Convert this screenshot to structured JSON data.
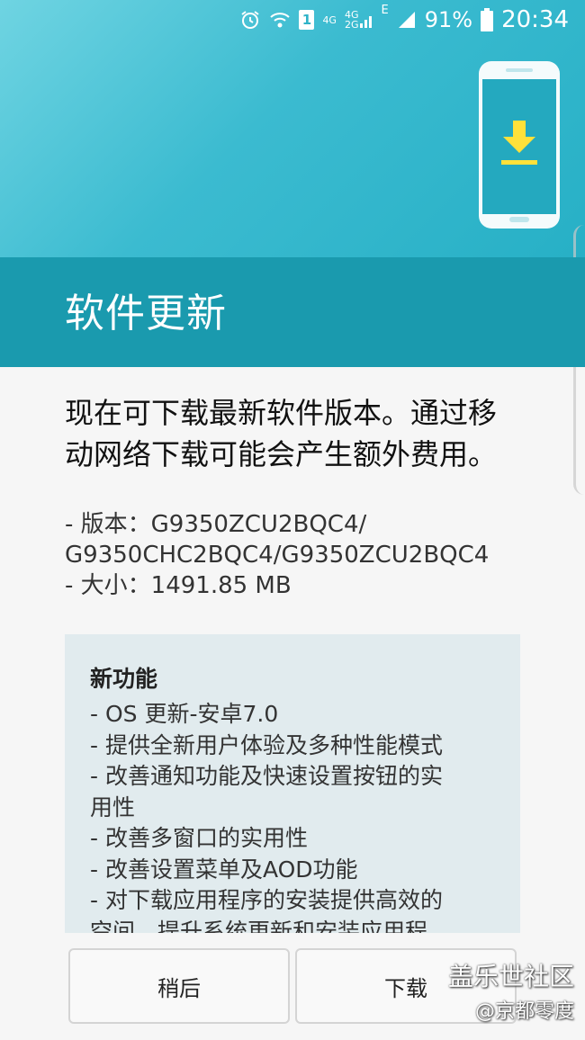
{
  "status_bar": {
    "sim_badge": "1",
    "net_top": "4G",
    "net_bottom": "2G",
    "net_label": "4G",
    "data_type": "E",
    "battery_percent": "91%",
    "time": "20:34"
  },
  "header": {
    "title": "软件更新"
  },
  "content": {
    "intro": "现在可下载最新软件版本。通过移动网络下载可能会产生额外费用。",
    "version_line1": "- 版本：G9350ZCU2BQC4/",
    "version_line2": "G9350CHC2BQC4/G9350ZCU2BQC4",
    "size_line": "- 大小：1491.85 MB"
  },
  "release_notes": {
    "heading": "新功能",
    "items": [
      "- OS 更新-安卓7.0",
      "- 提供全新用户体验及多种性能模式",
      "- 改善通知功能及快速设置按钮的实",
      "用性",
      "- 改善多窗口的实用性",
      "- 改善设置菜单及AOD功能",
      "- 对下载应用程序的安装提供高效的",
      "空间，提升系统更新和安装应用程"
    ]
  },
  "buttons": {
    "later": "稍后",
    "download": "下载"
  },
  "watermark": {
    "line1": "盖乐世社区",
    "line2": "@京都零度"
  }
}
